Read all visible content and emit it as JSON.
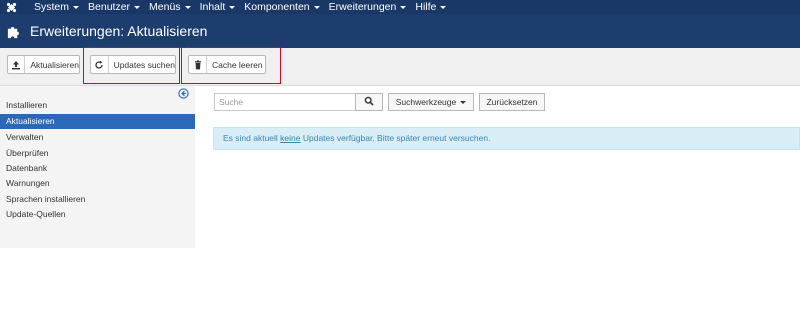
{
  "topnav": {
    "items": [
      {
        "label": "System"
      },
      {
        "label": "Benutzer"
      },
      {
        "label": "Menüs"
      },
      {
        "label": "Inhalt"
      },
      {
        "label": "Komponenten"
      },
      {
        "label": "Erweiterungen"
      },
      {
        "label": "Hilfe"
      }
    ]
  },
  "header": {
    "title": "Erweiterungen: Aktualisieren"
  },
  "toolbar": {
    "update_label": "Aktualisieren",
    "find_updates_label": "Updates suchen",
    "clear_cache_label": "Cache leeren"
  },
  "sidebar": {
    "items": [
      {
        "label": "Installieren"
      },
      {
        "label": "Aktualisieren"
      },
      {
        "label": "Verwalten"
      },
      {
        "label": "Überprüfen"
      },
      {
        "label": "Datenbank"
      },
      {
        "label": "Warnungen"
      },
      {
        "label": "Sprachen installieren"
      },
      {
        "label": "Update-Quellen"
      }
    ],
    "active": "Aktualisieren"
  },
  "filters": {
    "search_placeholder": "Suche",
    "search_tools_label": "Suchwerkzeuge",
    "reset_label": "Zurücksetzen"
  },
  "message": {
    "before": "Es sind aktuell ",
    "link": "keine",
    "after": " Updates verfügbar. Bitte später erneut versuchen."
  },
  "colors": {
    "topnav_bg": "#1a3867",
    "header_bg": "#1c3d6e",
    "active_item_bg": "#2a69b8",
    "alert_bg": "#d9edf7",
    "alert_text": "#3a87ad",
    "highlight_red": "#e0001a"
  },
  "icons": {
    "logo": "joomla-logo-icon",
    "header": "puzzle-icon",
    "update": "upload-icon",
    "find": "refresh-icon",
    "cache": "trash-icon",
    "search": "search-icon",
    "collapse": "arrow-left-circle-icon"
  }
}
